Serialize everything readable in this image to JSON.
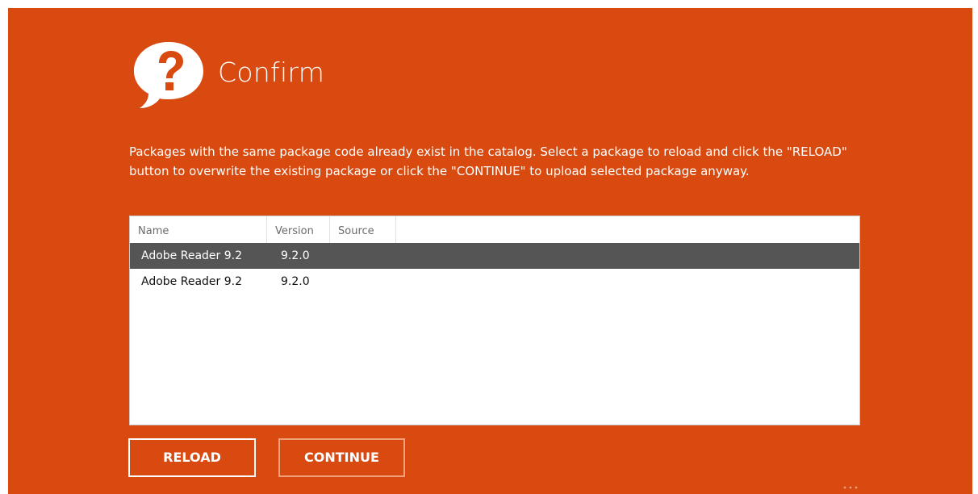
{
  "dialog": {
    "title": "Confirm",
    "title_icon": "question-speech-bubble-icon",
    "message": "Packages with the same package code already exist in the catalog. Select a package to reload and click the \"RELOAD\" button to overwrite the existing package or click the \"CONTINUE\" to upload selected package anyway.",
    "background_color": "#d84a0f",
    "selected_row_color": "#555555"
  },
  "list": {
    "columns": [
      "Name",
      "Version",
      "Source"
    ],
    "rows": [
      {
        "name": "Adobe Reader 9.2",
        "version": "9.2.0",
        "source": "",
        "selected": true
      },
      {
        "name": "Adobe Reader 9.2",
        "version": "9.2.0",
        "source": "",
        "selected": false
      }
    ]
  },
  "buttons": {
    "reload_label": "RELOAD",
    "continue_label": "CONTINUE"
  }
}
